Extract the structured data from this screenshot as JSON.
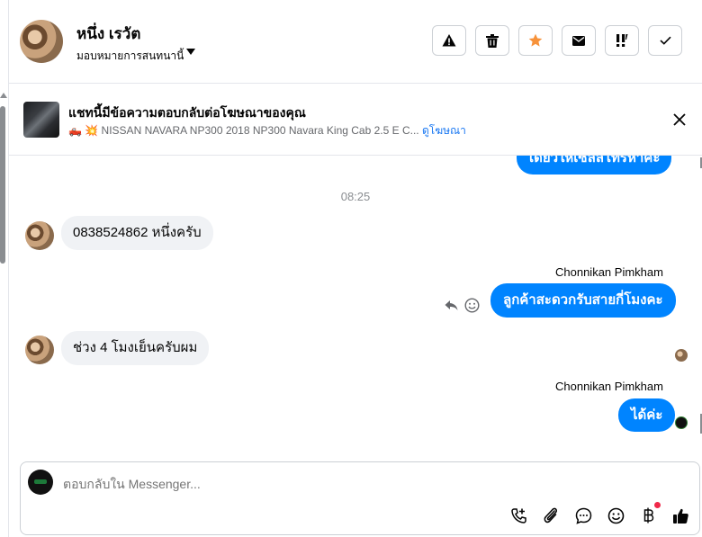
{
  "header": {
    "contact_name": "หนึ่ง เรวัต",
    "assign_label": "มอบหมายการสนทนานี้",
    "toolbar": [
      {
        "icon": "warning-icon",
        "name": "spam-button"
      },
      {
        "icon": "trash-icon",
        "name": "delete-button"
      },
      {
        "icon": "star-icon",
        "name": "star-button",
        "color": "#f7923a"
      },
      {
        "icon": "mail-icon",
        "name": "mark-unread-button"
      },
      {
        "icon": "follow-up-icon",
        "name": "follow-up-button"
      },
      {
        "icon": "check-icon",
        "name": "mark-done-button"
      }
    ]
  },
  "ad_banner": {
    "title": "แชทนี้มีข้อความตอบกลับต่อโฆษณาของคุณ",
    "emoji": "🛻 💥",
    "subtitle": " NISSAN NAVARA NP300 2018 NP300 Navara King Cab 2.5 E C...",
    "link": "ดูโฆษณา"
  },
  "messages": {
    "partial_out": "เดี๋ยวให้เซลล์โทรหาค่ะ",
    "timestamp": "08:25",
    "in_1": "0838524862 หนึ่งครับ",
    "sender_1": "Chonnikan Pimkham",
    "out_1": "ลูกค้าสะดวกรับสายกี่โมงคะ",
    "in_2": "ช่วง 4 โมงเย็นครับผม",
    "sender_2": "Chonnikan Pimkham",
    "out_2": "ได้ค่ะ"
  },
  "composer": {
    "placeholder": "ตอบกลับใน Messenger..."
  },
  "colors": {
    "accent": "#0084ff",
    "link": "#1877f2",
    "star": "#f7923a",
    "notification": "#f02849"
  }
}
